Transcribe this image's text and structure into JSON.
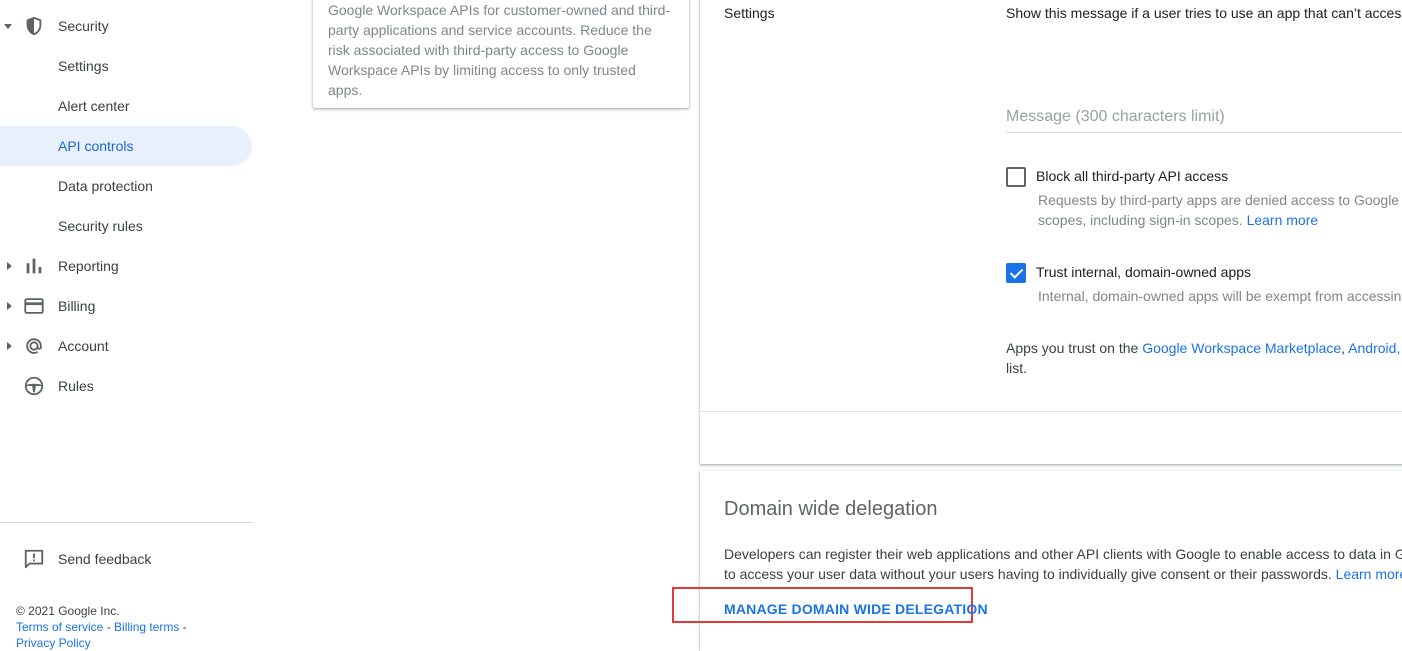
{
  "sidebar": {
    "items": [
      {
        "label": "Security",
        "icon": "shield-icon",
        "caret": "down"
      },
      {
        "label": "Settings"
      },
      {
        "label": "Alert center"
      },
      {
        "label": "API controls",
        "active": true
      },
      {
        "label": "Data protection"
      },
      {
        "label": "Security rules"
      },
      {
        "label": "Reporting",
        "icon": "bar-chart-icon",
        "caret": "right"
      },
      {
        "label": "Billing",
        "icon": "credit-card-icon",
        "caret": "right"
      },
      {
        "label": "Account",
        "icon": "at-sign-icon",
        "caret": "right"
      },
      {
        "label": "Rules",
        "icon": "steering-wheel-icon"
      }
    ],
    "feedback_label": "Send feedback",
    "copyright": "© 2021 Google Inc.",
    "terms_label": "Terms of service",
    "billing_terms_label": "Billing terms",
    "sep": " - ",
    "privacy_partial": "Privacy Policy"
  },
  "info_card": {
    "text_lines": [
      "Google Workspace APIs for customer-owned and third-",
      "party applications and service accounts. Reduce the",
      "risk associated with third-party access to Google",
      "Workspace APIs by limiting access to only trusted",
      "apps."
    ]
  },
  "settings": {
    "section_label": "Settings",
    "message_desc": "Show this message if a user tries to use an app that can’t access",
    "message_placeholder": "Message (300 characters limit)",
    "block_label": "Block all third-party API access",
    "block_desc_line1": "Requests by third-party apps are denied access to Google W",
    "block_desc_line2": "scopes, including sign-in scopes.",
    "learn_more": "Learn more",
    "block_checked": false,
    "trust_label": "Trust internal, domain-owned apps",
    "trust_desc": "Internal, domain-owned apps will be exempt from accessing",
    "trust_checked": true,
    "apps_trust_prefix": "Apps you trust on the ",
    "marketplace_link": "Google Workspace Marketplace",
    "comma": ", ",
    "android_link": "Android",
    "comma2": ", c",
    "list_suffix": "list."
  },
  "dwd": {
    "title": "Domain wide delegation",
    "desc_line1": "Developers can register their web applications and other API clients with Google to enable access to data in G",
    "desc_line2": "to access your user data without your users having to individually give consent or their passwords.",
    "learn_more": "Learn more",
    "manage_button": "MANAGE DOMAIN WIDE DELEGATION"
  },
  "colors": {
    "accent": "#1a73e8",
    "active_bg": "#e8f0fe",
    "highlight_border": "#e53935"
  }
}
